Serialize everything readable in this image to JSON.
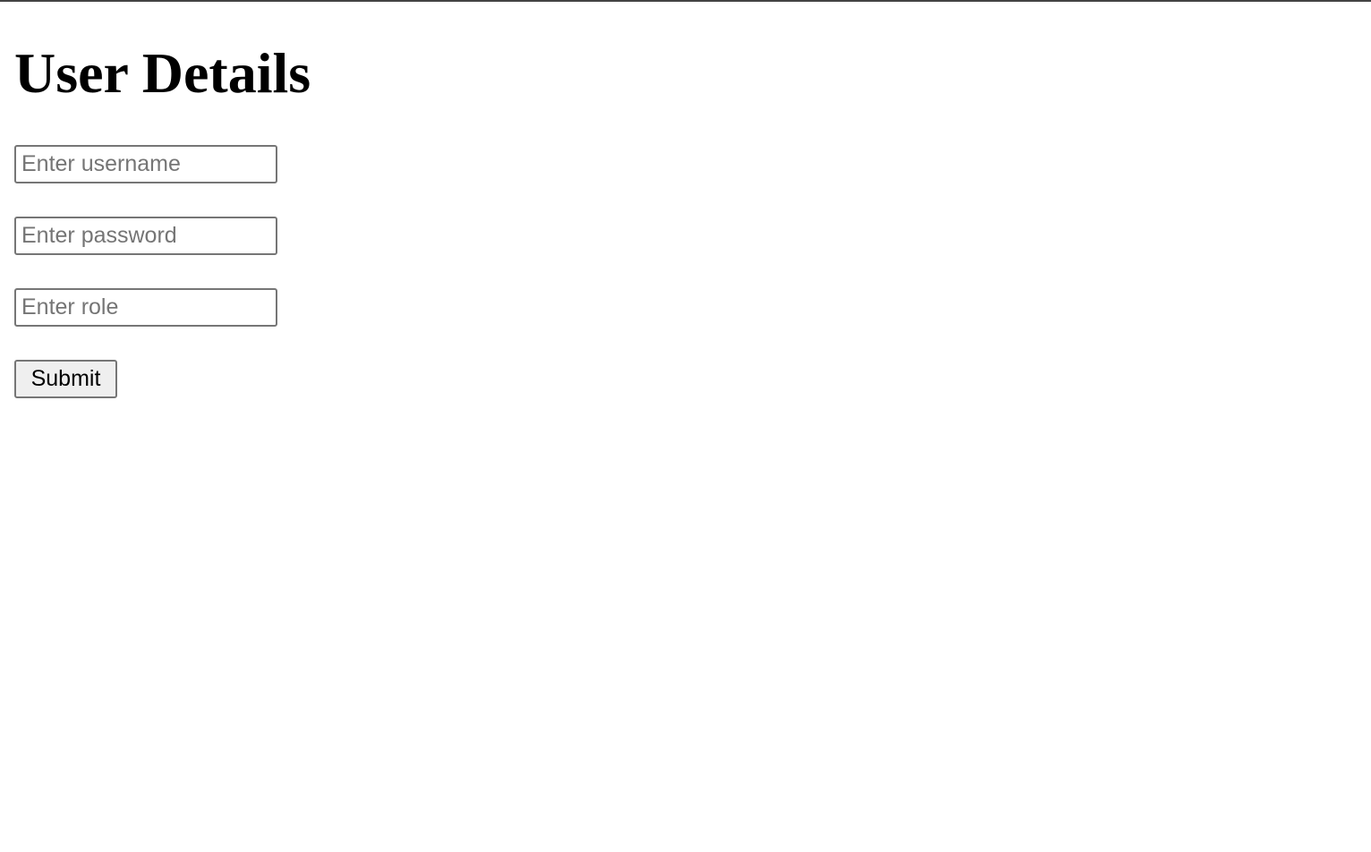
{
  "page": {
    "title": "User Details"
  },
  "form": {
    "username": {
      "placeholder": "Enter username",
      "value": ""
    },
    "password": {
      "placeholder": "Enter password",
      "value": ""
    },
    "role": {
      "placeholder": "Enter role",
      "value": ""
    },
    "submit_label": "Submit"
  }
}
